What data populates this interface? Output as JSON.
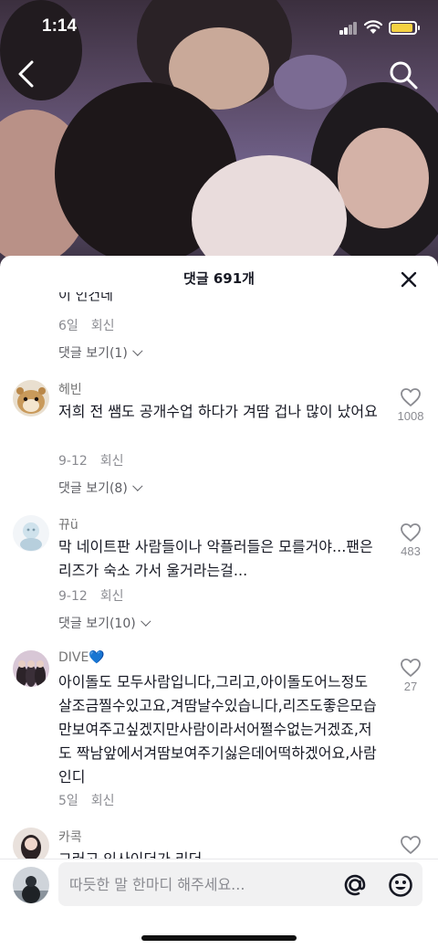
{
  "status_bar": {
    "time": "1:14"
  },
  "sheet": {
    "title": "댓글 691개"
  },
  "partial_comment": {
    "text_cut": "이 인건데",
    "date": "6일",
    "reply_label": "회신",
    "view_replies": "댓글 보기(1)"
  },
  "comments": [
    {
      "username": "헤빈",
      "text": "저희 전 쌤도 공개수업 하다가 겨땀 겁나 많이 났어요",
      "date": "9-12",
      "reply_label": "회신",
      "view_replies": "댓글 보기(8)",
      "likes": "1008"
    },
    {
      "username": "뀨ü",
      "text": "막 네이트판 사람들이나 악플러들은 모를거야...팬은 리즈가 숙소 가서 울거라는걸...",
      "date": "9-12",
      "reply_label": "회신",
      "view_replies": "댓글 보기(10)",
      "likes": "483"
    },
    {
      "username": "DIVE💙",
      "text": "아이돌도 모두사람입니다,그리고,아이돌도어느정도살조금찔수있고요,겨땀날수있습니다,리즈도좋은모습만보여주고싶겠지만사람이라서어쩔수없는거겠죠,저도 짝남앞에서겨땀보여주기싫은데어떡하겠어요,사람인디",
      "date": "5일",
      "reply_label": "회신",
      "likes": "27"
    },
    {
      "username": "카콕",
      "text": "그러고 인사이더가 리더"
    }
  ],
  "input": {
    "placeholder": "따듯한 말 한마디 해주세요..."
  },
  "colors": {
    "battery": "#f5d142",
    "text_primary": "#161823",
    "text_secondary": "#8a8b91"
  }
}
